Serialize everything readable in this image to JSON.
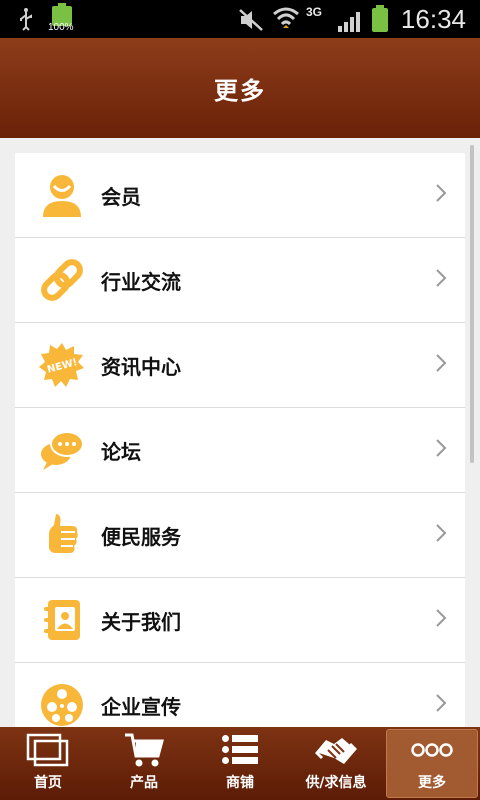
{
  "status_bar": {
    "battery_small": "100%",
    "network": "3G",
    "time": "16:34"
  },
  "header": {
    "title": "更多"
  },
  "menu": {
    "items": [
      {
        "label": "会员",
        "icon": "user-icon"
      },
      {
        "label": "行业交流",
        "icon": "link-icon"
      },
      {
        "label": "资讯中心",
        "icon": "new-badge-icon",
        "badge": "NEW!"
      },
      {
        "label": "论坛",
        "icon": "chat-bubbles-icon"
      },
      {
        "label": "便民服务",
        "icon": "thumbs-up-icon"
      },
      {
        "label": "关于我们",
        "icon": "contact-book-icon"
      },
      {
        "label": "企业宣传",
        "icon": "film-reel-icon"
      }
    ]
  },
  "tabbar": {
    "tabs": [
      {
        "label": "首页",
        "icon": "home-windows-icon"
      },
      {
        "label": "产品",
        "icon": "cart-icon"
      },
      {
        "label": "商铺",
        "icon": "list-icon"
      },
      {
        "label": "供/求信息",
        "icon": "handshake-icon"
      },
      {
        "label": "更多",
        "icon": "more-dots-icon",
        "active": true
      }
    ]
  },
  "colors": {
    "accent": "#f9b73a",
    "header": "#7a2c10",
    "tab_active": "#a25a30"
  }
}
